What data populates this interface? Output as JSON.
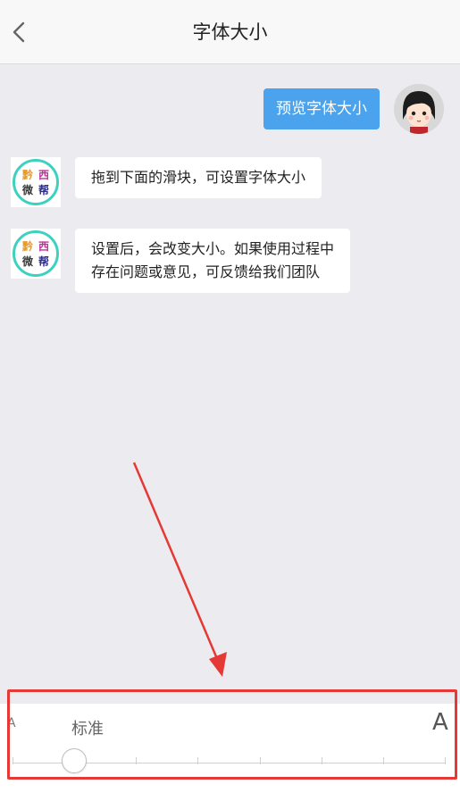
{
  "header": {
    "title": "字体大小",
    "back_icon": "chevron-left-icon"
  },
  "chat": {
    "preview_message": "预览字体大小",
    "bot_avatar_chars": [
      "黔",
      "西",
      "微",
      "帮"
    ],
    "bot_messages": [
      {
        "lines": [
          "拖到下面的滑块，可设置字体大小"
        ]
      },
      {
        "lines": [
          "设置后，会改变大小。如果使用过程中",
          "存在问题或意见，可反馈给我们团队"
        ]
      }
    ]
  },
  "slider": {
    "small_label": "A",
    "current_label": "标准",
    "large_label": "A",
    "step_count": 7,
    "selected_step": 1
  },
  "colors": {
    "accent_blue": "#4aa3ec",
    "highlight_red": "#e53935",
    "bot_ring": "#3ed1c0"
  }
}
